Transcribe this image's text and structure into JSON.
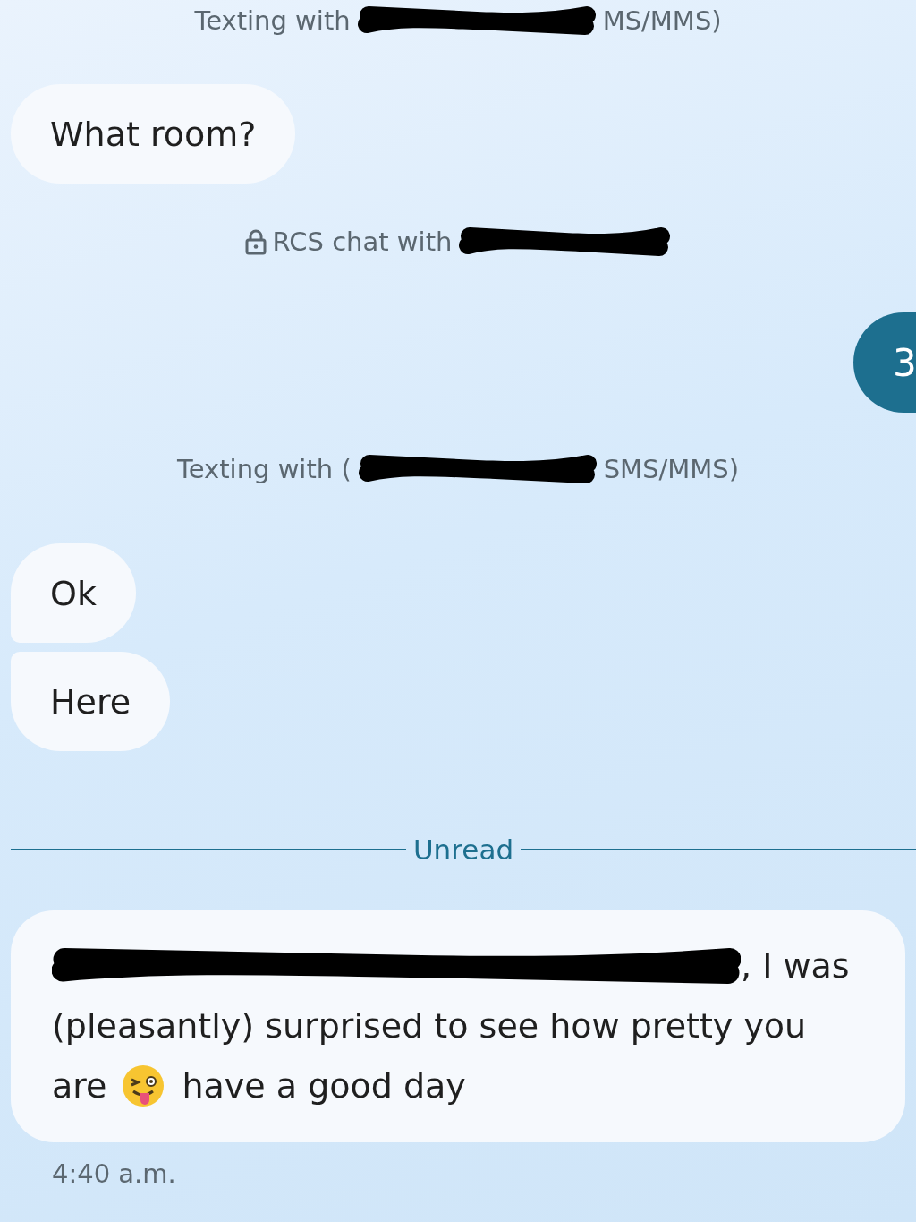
{
  "thread": [
    {
      "kind": "notice",
      "before": "Texting with",
      "after": "MS/MMS)"
    },
    {
      "kind": "message",
      "text": "What room?"
    },
    {
      "kind": "rcs_notice",
      "before": "RCS chat with"
    },
    {
      "kind": "badge",
      "text": "3"
    },
    {
      "kind": "notice",
      "before": "Texting with (",
      "after": "SMS/MMS)"
    },
    {
      "kind": "message",
      "text": "Ok"
    },
    {
      "kind": "message",
      "text": "Here"
    },
    {
      "kind": "divider",
      "text": "Unread"
    },
    {
      "kind": "long_message",
      "line_1": ", I was",
      "line_2": "(pleasantly) surprised to see how pretty you",
      "line_3a": "are",
      "line_3b": "have a good day"
    },
    {
      "kind": "time",
      "text": "4:40 a.m."
    }
  ]
}
